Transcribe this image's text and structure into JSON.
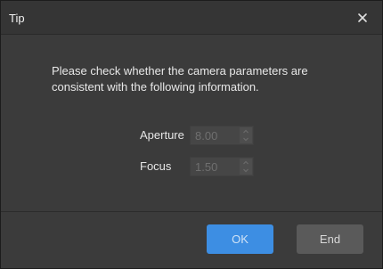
{
  "dialog": {
    "title": "Tip",
    "message": "Please check whether the camera parameters are consistent with the following information.",
    "fields": [
      {
        "label": "Aperture",
        "value": "8.00"
      },
      {
        "label": "Focus",
        "value": "1.50"
      }
    ],
    "buttons": {
      "ok": "OK",
      "end": "End"
    }
  },
  "icons": {
    "close": "close-icon",
    "spin_up": "chevron-up-icon",
    "spin_down": "chevron-down-icon"
  },
  "colors": {
    "dialog_background": "#3b3b3b",
    "titlebar_background": "#353535",
    "primary_button": "#3d8ee3",
    "secondary_button": "#5a5a5a",
    "disabled_text": "#6f6f6f"
  }
}
